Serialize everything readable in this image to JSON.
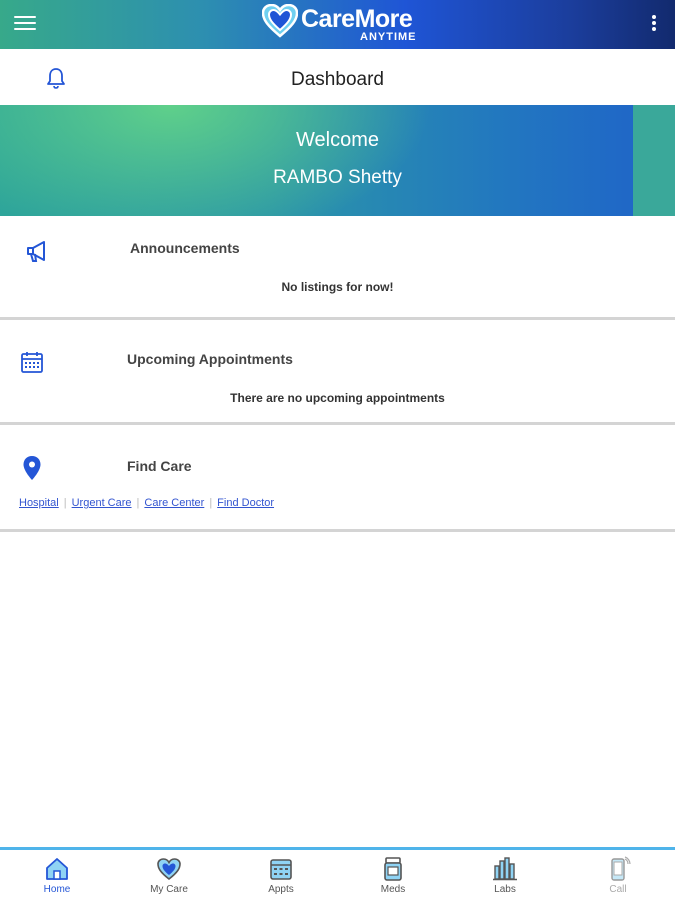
{
  "app": {
    "logo_main": "CareMore",
    "logo_sub": "ANYTIME",
    "brand_colors": {
      "primary": "#1f55d6",
      "teal": "#37a98a",
      "accent": "#4fb4ea"
    }
  },
  "header": {
    "title": "Dashboard"
  },
  "welcome": {
    "greeting": "Welcome",
    "user_name": "RAMBO Shetty"
  },
  "announcements": {
    "title": "Announcements",
    "message": "No listings for now!"
  },
  "appointments": {
    "title": "Upcoming Appointments",
    "message": "There are no upcoming appointments"
  },
  "find_care": {
    "title": "Find Care",
    "links": [
      "Hospital",
      "Urgent Care",
      "Care Center",
      "Find Doctor"
    ]
  },
  "bottom_nav": {
    "items": [
      {
        "label": "Home",
        "icon": "home-icon",
        "active": true
      },
      {
        "label": "My Care",
        "icon": "heart-icon",
        "active": false
      },
      {
        "label": "Appts",
        "icon": "calendar-icon",
        "active": false
      },
      {
        "label": "Meds",
        "icon": "pill-bottle-icon",
        "active": false
      },
      {
        "label": "Labs",
        "icon": "labs-icon",
        "active": false
      },
      {
        "label": "Call",
        "icon": "phone-icon",
        "active": false
      }
    ]
  }
}
